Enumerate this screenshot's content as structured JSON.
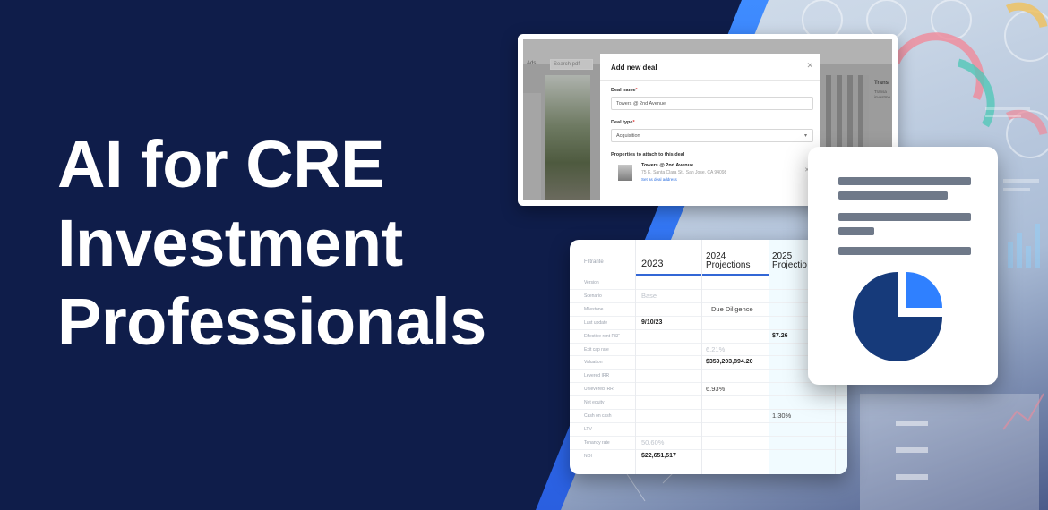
{
  "headline": [
    "AI for CRE",
    "Investment",
    "Professionals"
  ],
  "colors": {
    "navy": "#0f1d4a",
    "accent_blue": "#3f8cff",
    "pie_navy": "#163a7a",
    "pie_blue": "#2f80ff",
    "doc_line": "#6f7989"
  },
  "deal_modal": {
    "background_tab": "Ads",
    "background_search": "Search pdf",
    "background_right_title": "Trans",
    "background_right_sub1": "Transa",
    "background_right_sub2": "investme",
    "title": "Add new deal",
    "close_icon": "close-icon",
    "deal_name_label": "Deal name",
    "deal_name_value": "Towers @ 2nd Avenue",
    "deal_type_label": "Deal type",
    "deal_type_value": "Acquisition",
    "properties_label": "Properties to attach to this deal",
    "property": {
      "name": "Towers @ 2nd Avenue",
      "address": "75 E. Santa Clara St., San Jose, CA 94098",
      "link": "Set as deal address"
    }
  },
  "projections_table": {
    "filter_label": "Filtrante",
    "columns": [
      "2023",
      "2024",
      "2025"
    ],
    "column_subtitles": [
      "",
      "Projections",
      "Projectio"
    ],
    "rows": [
      {
        "label": "Version",
        "values": [
          "",
          "",
          ""
        ]
      },
      {
        "label": "Scenario",
        "values": [
          "Base",
          "",
          ""
        ]
      },
      {
        "label": "Milestone",
        "values": [
          "",
          "Due Diligence",
          ""
        ]
      },
      {
        "label": "Last update",
        "values": [
          "9/10/23",
          "",
          ""
        ]
      },
      {
        "label": "Effective rent PSF",
        "values": [
          "",
          "",
          "$7.26"
        ]
      },
      {
        "label": "Exit cap rate",
        "values": [
          "",
          "6.21%",
          ""
        ]
      },
      {
        "label": "Valuation",
        "values": [
          "",
          "$359,203,894.20",
          ""
        ]
      },
      {
        "label": "Levered IRR",
        "values": [
          "",
          "",
          ""
        ]
      },
      {
        "label": "Unlevered IRR",
        "values": [
          "",
          "6.93%",
          ""
        ]
      },
      {
        "label": "Net equity",
        "values": [
          "",
          "",
          ""
        ]
      },
      {
        "label": "Cash on cash",
        "values": [
          "",
          "",
          "1.30%"
        ]
      },
      {
        "label": "LTV",
        "values": [
          "",
          "",
          ""
        ]
      },
      {
        "label": "Tenancy rate",
        "values": [
          "50.60%",
          "",
          ""
        ]
      },
      {
        "label": "NOI",
        "values": [
          "$22,651,517",
          "",
          ""
        ]
      }
    ]
  },
  "document_card": {
    "icon": "document-report-icon",
    "pie_fraction_highlighted": 0.25
  }
}
